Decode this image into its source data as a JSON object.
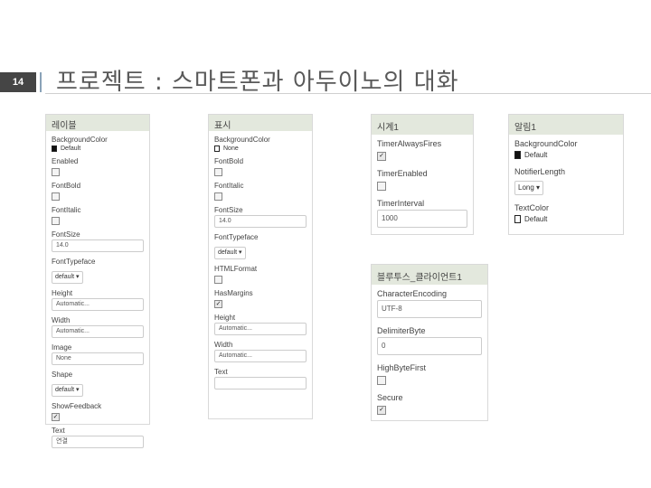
{
  "slide": {
    "number": "14",
    "title": "프로젝트 : 스마트폰과 아두이노의 대화"
  },
  "panels": [
    {
      "header": "레이블",
      "props": [
        {
          "label": "BackgroundColor",
          "type": "color",
          "value": "Default",
          "swatch": "#111111"
        },
        {
          "label": "Enabled",
          "type": "checkbox",
          "checked": false
        },
        {
          "label": "FontBold",
          "type": "checkbox",
          "checked": false
        },
        {
          "label": "FontItalic",
          "type": "checkbox",
          "checked": false
        },
        {
          "label": "FontSize",
          "type": "input",
          "value": "14.0"
        },
        {
          "label": "FontTypeface",
          "type": "select",
          "value": "default"
        },
        {
          "label": "Height",
          "type": "input",
          "value": "Automatic..."
        },
        {
          "label": "Width",
          "type": "input",
          "value": "Automatic..."
        },
        {
          "label": "Image",
          "type": "input",
          "value": "None"
        },
        {
          "label": "Shape",
          "type": "select",
          "value": "default"
        },
        {
          "label": "ShowFeedback",
          "type": "checkbox",
          "checked": true
        },
        {
          "label": "Text",
          "type": "input",
          "value": "연결"
        }
      ]
    },
    {
      "header": "표시",
      "props": [
        {
          "label": "BackgroundColor",
          "type": "color",
          "value": "None",
          "swatch": "#ffffff"
        },
        {
          "label": "FontBold",
          "type": "checkbox",
          "checked": false
        },
        {
          "label": "FontItalic",
          "type": "checkbox",
          "checked": false
        },
        {
          "label": "FontSize",
          "type": "input",
          "value": "14.0"
        },
        {
          "label": "FontTypeface",
          "type": "select",
          "value": "default"
        },
        {
          "label": "HTMLFormat",
          "type": "checkbox",
          "checked": false
        },
        {
          "label": "HasMargins",
          "type": "checkbox",
          "checked": true
        },
        {
          "label": "Height",
          "type": "input",
          "value": "Automatic..."
        },
        {
          "label": "Width",
          "type": "input",
          "value": "Automatic..."
        },
        {
          "label": "Text",
          "type": "input",
          "value": ""
        }
      ]
    },
    {
      "header": "시계1",
      "props": [
        {
          "label": "TimerAlwaysFires",
          "type": "checkbox",
          "checked": true
        },
        {
          "label": "TimerEnabled",
          "type": "checkbox",
          "checked": false
        },
        {
          "label": "TimerInterval",
          "type": "input",
          "value": "1000"
        }
      ]
    },
    {
      "header": "알림1",
      "props": [
        {
          "label": "BackgroundColor",
          "type": "color",
          "value": "Default",
          "swatch": "#111111"
        },
        {
          "label": "NotifierLength",
          "type": "select",
          "value": "Long"
        },
        {
          "label": "TextColor",
          "type": "color",
          "value": "Default",
          "swatch": "#ffffff"
        }
      ]
    },
    {
      "header": "블루투스_클라이언트1",
      "props": [
        {
          "label": "CharacterEncoding",
          "type": "input",
          "value": "UTF-8"
        },
        {
          "label": "DelimiterByte",
          "type": "input",
          "value": "0"
        },
        {
          "label": "HighByteFirst",
          "type": "checkbox",
          "checked": false
        },
        {
          "label": "Secure",
          "type": "checkbox",
          "checked": true
        }
      ]
    }
  ]
}
